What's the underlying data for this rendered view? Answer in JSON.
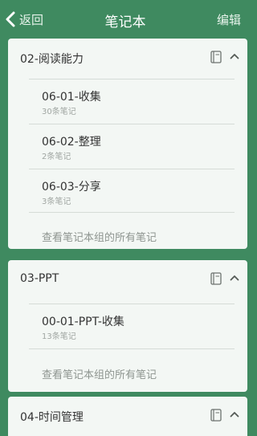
{
  "nav": {
    "back_label": "返回",
    "title": "笔记本",
    "edit_label": "编辑"
  },
  "groups": [
    {
      "title": "02-阅读能力",
      "expanded": true,
      "notebooks": [
        {
          "title": "06-01-收集",
          "count": "30条笔记"
        },
        {
          "title": "06-02-整理",
          "count": "2条笔记"
        },
        {
          "title": "06-03-分享",
          "count": "3条笔记"
        }
      ],
      "view_all": "查看笔记本组的所有笔记"
    },
    {
      "title": "03-PPT",
      "expanded": true,
      "notebooks": [
        {
          "title": "00-01-PPT-收集",
          "count": "13条笔记"
        }
      ],
      "view_all": "查看笔记本组的所有笔记"
    },
    {
      "title": "04-时间管理",
      "expanded": true,
      "notebooks": [],
      "view_all": ""
    }
  ],
  "colors": {
    "header_green": "#3f8a60",
    "card_bg": "#f3f7f4",
    "separator": "#d5dcd7"
  },
  "icons": {
    "back": "chevron-left-icon",
    "notebook": "notebook-icon",
    "collapse": "chevron-up-icon"
  }
}
